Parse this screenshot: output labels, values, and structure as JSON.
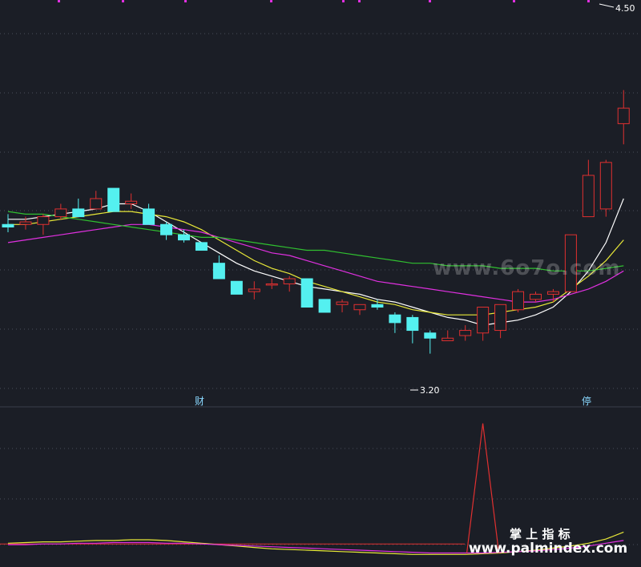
{
  "chart_data": {
    "type": "candlestick",
    "price_axis": {
      "ylim": [
        3.05,
        4.55
      ]
    },
    "annotations": {
      "high_label": "4.50",
      "low_label": "3.20",
      "marker_left": "财",
      "marker_right": "停"
    },
    "watermarks": {
      "top": "www.6o7o.com",
      "bottom_cn": "掌 上 指 标",
      "bottom_url": "www.palmindex.com"
    },
    "colors": {
      "up": "#e03030",
      "down": "#54f0f0",
      "ma_white": "#ffffff",
      "ma_yellow": "#e8e838",
      "ma_magenta": "#e030e0",
      "ma_green": "#30c030",
      "background": "#1b1e26",
      "grid": "#4a4f5a"
    },
    "candles": [
      {
        "o": 3.7,
        "h": 3.74,
        "l": 3.67,
        "c": 3.69
      },
      {
        "o": 3.7,
        "h": 3.73,
        "l": 3.68,
        "c": 3.71
      },
      {
        "o": 3.7,
        "h": 3.74,
        "l": 3.66,
        "c": 3.73
      },
      {
        "o": 3.73,
        "h": 3.78,
        "l": 3.72,
        "c": 3.76
      },
      {
        "o": 3.76,
        "h": 3.8,
        "l": 3.74,
        "c": 3.73
      },
      {
        "o": 3.76,
        "h": 3.83,
        "l": 3.76,
        "c": 3.8
      },
      {
        "o": 3.84,
        "h": 3.84,
        "l": 3.75,
        "c": 3.75
      },
      {
        "o": 3.78,
        "h": 3.82,
        "l": 3.76,
        "c": 3.79
      },
      {
        "o": 3.76,
        "h": 3.78,
        "l": 3.7,
        "c": 3.7
      },
      {
        "o": 3.7,
        "h": 3.71,
        "l": 3.64,
        "c": 3.66
      },
      {
        "o": 3.66,
        "h": 3.68,
        "l": 3.63,
        "c": 3.64
      },
      {
        "o": 3.63,
        "h": 3.63,
        "l": 3.6,
        "c": 3.6
      },
      {
        "o": 3.55,
        "h": 3.58,
        "l": 3.49,
        "c": 3.49
      },
      {
        "o": 3.48,
        "h": 3.48,
        "l": 3.43,
        "c": 3.43
      },
      {
        "o": 3.44,
        "h": 3.48,
        "l": 3.41,
        "c": 3.45
      },
      {
        "o": 3.47,
        "h": 3.49,
        "l": 3.45,
        "c": 3.47
      },
      {
        "o": 3.47,
        "h": 3.5,
        "l": 3.44,
        "c": 3.49
      },
      {
        "o": 3.49,
        "h": 3.49,
        "l": 3.38,
        "c": 3.38
      },
      {
        "o": 3.41,
        "h": 3.41,
        "l": 3.36,
        "c": 3.36
      },
      {
        "o": 3.39,
        "h": 3.41,
        "l": 3.36,
        "c": 3.4
      },
      {
        "o": 3.37,
        "h": 3.39,
        "l": 3.35,
        "c": 3.39
      },
      {
        "o": 3.39,
        "h": 3.41,
        "l": 3.37,
        "c": 3.38
      },
      {
        "o": 3.35,
        "h": 3.36,
        "l": 3.28,
        "c": 3.32
      },
      {
        "o": 3.34,
        "h": 3.35,
        "l": 3.24,
        "c": 3.29
      },
      {
        "o": 3.28,
        "h": 3.29,
        "l": 3.2,
        "c": 3.26
      },
      {
        "o": 3.25,
        "h": 3.29,
        "l": 3.25,
        "c": 3.26
      },
      {
        "o": 3.27,
        "h": 3.31,
        "l": 3.25,
        "c": 3.29
      },
      {
        "o": 3.28,
        "h": 3.3,
        "l": 3.25,
        "c": 3.38
      },
      {
        "o": 3.29,
        "h": 3.31,
        "l": 3.26,
        "c": 3.39
      },
      {
        "o": 3.37,
        "h": 3.45,
        "l": 3.36,
        "c": 3.44
      },
      {
        "o": 3.41,
        "h": 3.44,
        "l": 3.4,
        "c": 3.43
      },
      {
        "o": 3.43,
        "h": 3.45,
        "l": 3.4,
        "c": 3.44
      },
      {
        "o": 3.44,
        "h": 3.66,
        "l": 3.44,
        "c": 3.66
      },
      {
        "o": 3.73,
        "h": 3.95,
        "l": 3.73,
        "c": 3.89
      },
      {
        "o": 3.76,
        "h": 3.95,
        "l": 3.73,
        "c": 3.94
      },
      {
        "o": 4.09,
        "h": 4.22,
        "l": 4.01,
        "c": 4.15
      }
    ],
    "moving_averages": [
      {
        "color_key": "ma_white",
        "values": [
          3.72,
          3.72,
          3.73,
          3.74,
          3.75,
          3.76,
          3.78,
          3.78,
          3.75,
          3.71,
          3.67,
          3.63,
          3.59,
          3.55,
          3.52,
          3.5,
          3.48,
          3.46,
          3.45,
          3.44,
          3.43,
          3.41,
          3.4,
          3.38,
          3.36,
          3.34,
          3.33,
          3.31,
          3.32,
          3.33,
          3.35,
          3.38,
          3.44,
          3.52,
          3.63,
          3.8
        ]
      },
      {
        "color_key": "ma_yellow",
        "values": [
          3.7,
          3.7,
          3.71,
          3.72,
          3.73,
          3.74,
          3.75,
          3.75,
          3.74,
          3.73,
          3.71,
          3.68,
          3.64,
          3.6,
          3.56,
          3.53,
          3.51,
          3.48,
          3.46,
          3.44,
          3.42,
          3.4,
          3.39,
          3.37,
          3.36,
          3.35,
          3.35,
          3.35,
          3.36,
          3.37,
          3.38,
          3.4,
          3.45,
          3.5,
          3.56,
          3.64
        ]
      },
      {
        "color_key": "ma_magenta",
        "values": [
          3.63,
          3.64,
          3.65,
          3.66,
          3.67,
          3.68,
          3.69,
          3.7,
          3.7,
          3.69,
          3.68,
          3.67,
          3.65,
          3.63,
          3.61,
          3.59,
          3.58,
          3.56,
          3.54,
          3.52,
          3.5,
          3.48,
          3.47,
          3.46,
          3.45,
          3.44,
          3.43,
          3.42,
          3.41,
          3.4,
          3.4,
          3.41,
          3.43,
          3.45,
          3.48,
          3.52
        ]
      },
      {
        "color_key": "ma_green",
        "values": [
          3.75,
          3.74,
          3.74,
          3.73,
          3.72,
          3.71,
          3.7,
          3.69,
          3.68,
          3.67,
          3.66,
          3.65,
          3.65,
          3.64,
          3.63,
          3.62,
          3.61,
          3.6,
          3.6,
          3.59,
          3.58,
          3.57,
          3.56,
          3.55,
          3.55,
          3.54,
          3.54,
          3.54,
          3.53,
          3.53,
          3.53,
          3.52,
          3.52,
          3.52,
          3.53,
          3.54
        ]
      }
    ],
    "indicator": {
      "ylim": [
        0,
        10
      ],
      "spike_index": 27,
      "spike_value": 9.5,
      "spike_color": "#e03030",
      "lines": [
        {
          "color_key": "ma_yellow",
          "values": [
            0.9,
            0.95,
            1.0,
            1.0,
            1.05,
            1.1,
            1.1,
            1.15,
            1.15,
            1.1,
            1.0,
            0.9,
            0.8,
            0.7,
            0.6,
            0.5,
            0.45,
            0.4,
            0.35,
            0.3,
            0.25,
            0.2,
            0.15,
            0.1,
            0.1,
            0.1,
            0.1,
            0.15,
            0.2,
            0.3,
            0.4,
            0.55,
            0.7,
            0.9,
            1.2,
            1.7
          ]
        },
        {
          "color_key": "ma_magenta",
          "values": [
            0.8,
            0.8,
            0.85,
            0.85,
            0.9,
            0.9,
            0.95,
            0.95,
            0.95,
            0.9,
            0.9,
            0.85,
            0.8,
            0.75,
            0.7,
            0.65,
            0.6,
            0.55,
            0.5,
            0.45,
            0.4,
            0.35,
            0.3,
            0.25,
            0.2,
            0.2,
            0.2,
            0.2,
            0.25,
            0.3,
            0.35,
            0.45,
            0.55,
            0.7,
            0.9,
            1.1
          ]
        }
      ]
    }
  }
}
